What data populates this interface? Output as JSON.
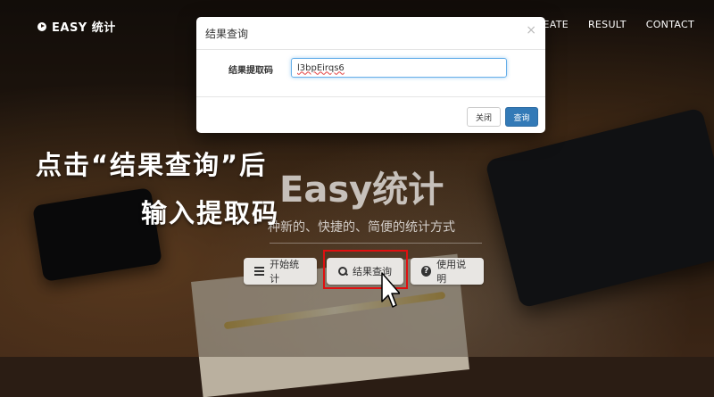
{
  "nav": {
    "brand": "EASY 统计",
    "links": [
      "CREATE",
      "RESULT",
      "CONTACT"
    ]
  },
  "hero": {
    "title": "Easy统计",
    "subtitle": "种新的、快捷的、简便的统计方式",
    "buttons": {
      "start": "开始统计",
      "query": "结果查询",
      "help": "使用说明"
    }
  },
  "captions": {
    "line1": "点击“结果查询”后",
    "line2": "输入提取码"
  },
  "modal": {
    "title": "结果查询",
    "close_glyph": "×",
    "field_label": "结果提取码",
    "field_value": "l3bpEirqs6",
    "close_button": "关闭",
    "submit_button": "查询"
  },
  "colors": {
    "primary": "#337ab7",
    "highlight": "#e01010"
  },
  "icons": {
    "brand": "play-circle-icon",
    "start": "list-icon",
    "query": "search-icon",
    "help": "question-circle-icon",
    "pointer": "cursor-arrow-icon"
  }
}
